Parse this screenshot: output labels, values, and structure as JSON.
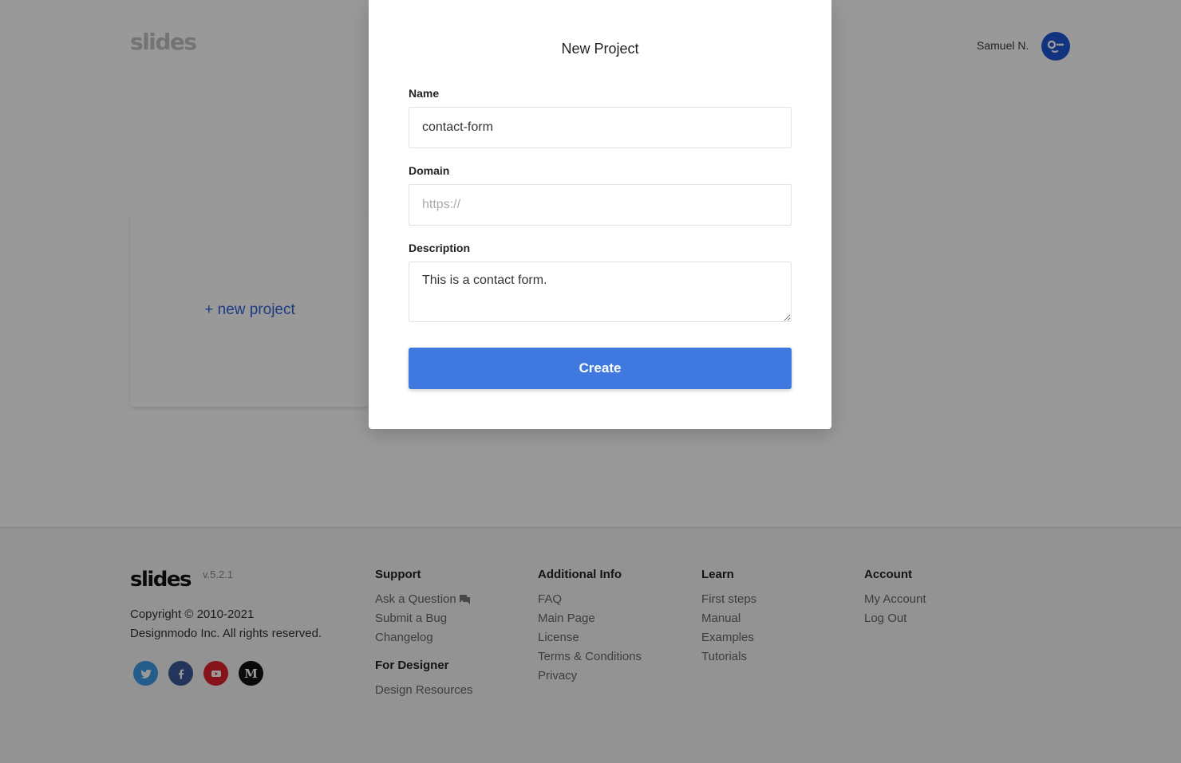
{
  "header": {
    "logo": "slides",
    "user_name": "Samuel N.",
    "avatar_icon": "avatar-face-icon"
  },
  "projects": {
    "new_project_label": "+ new project"
  },
  "modal": {
    "title": "New Project",
    "fields": {
      "name": {
        "label": "Name",
        "value": "contact-form",
        "placeholder": ""
      },
      "domain": {
        "label": "Domain",
        "value": "",
        "placeholder": "https://"
      },
      "description": {
        "label": "Description",
        "value": "This is a contact form."
      }
    },
    "create_label": "Create",
    "accent_color": "#3f78df"
  },
  "footer": {
    "logo": "slides",
    "version": "v.5.2.1",
    "copyright_line1": "Copyright © 2010-2021",
    "copyright_line2": "Designmodo Inc. All rights reserved.",
    "socials": [
      {
        "name": "twitter",
        "icon": "twitter-icon",
        "color": "#3d9ae8"
      },
      {
        "name": "facebook",
        "icon": "facebook-icon",
        "color": "#3b5998"
      },
      {
        "name": "youtube",
        "icon": "youtube-icon",
        "color": "#e0202a"
      },
      {
        "name": "medium",
        "icon": "medium-icon",
        "color": "#111111",
        "glyph": "M"
      }
    ],
    "columns": {
      "support": {
        "title": "Support",
        "links": [
          "Ask a Question",
          "Submit a Bug",
          "Changelog"
        ],
        "sub_title": "For Designer",
        "sub_links": [
          "Design Resources"
        ]
      },
      "additional": {
        "title": "Additional Info",
        "links": [
          "FAQ",
          "Main Page",
          "License",
          "Terms & Conditions",
          "Privacy"
        ]
      },
      "learn": {
        "title": "Learn",
        "links": [
          "First steps",
          "Manual",
          "Examples",
          "Tutorials"
        ]
      },
      "account": {
        "title": "Account",
        "links": [
          "My Account",
          "Log Out"
        ]
      }
    }
  }
}
